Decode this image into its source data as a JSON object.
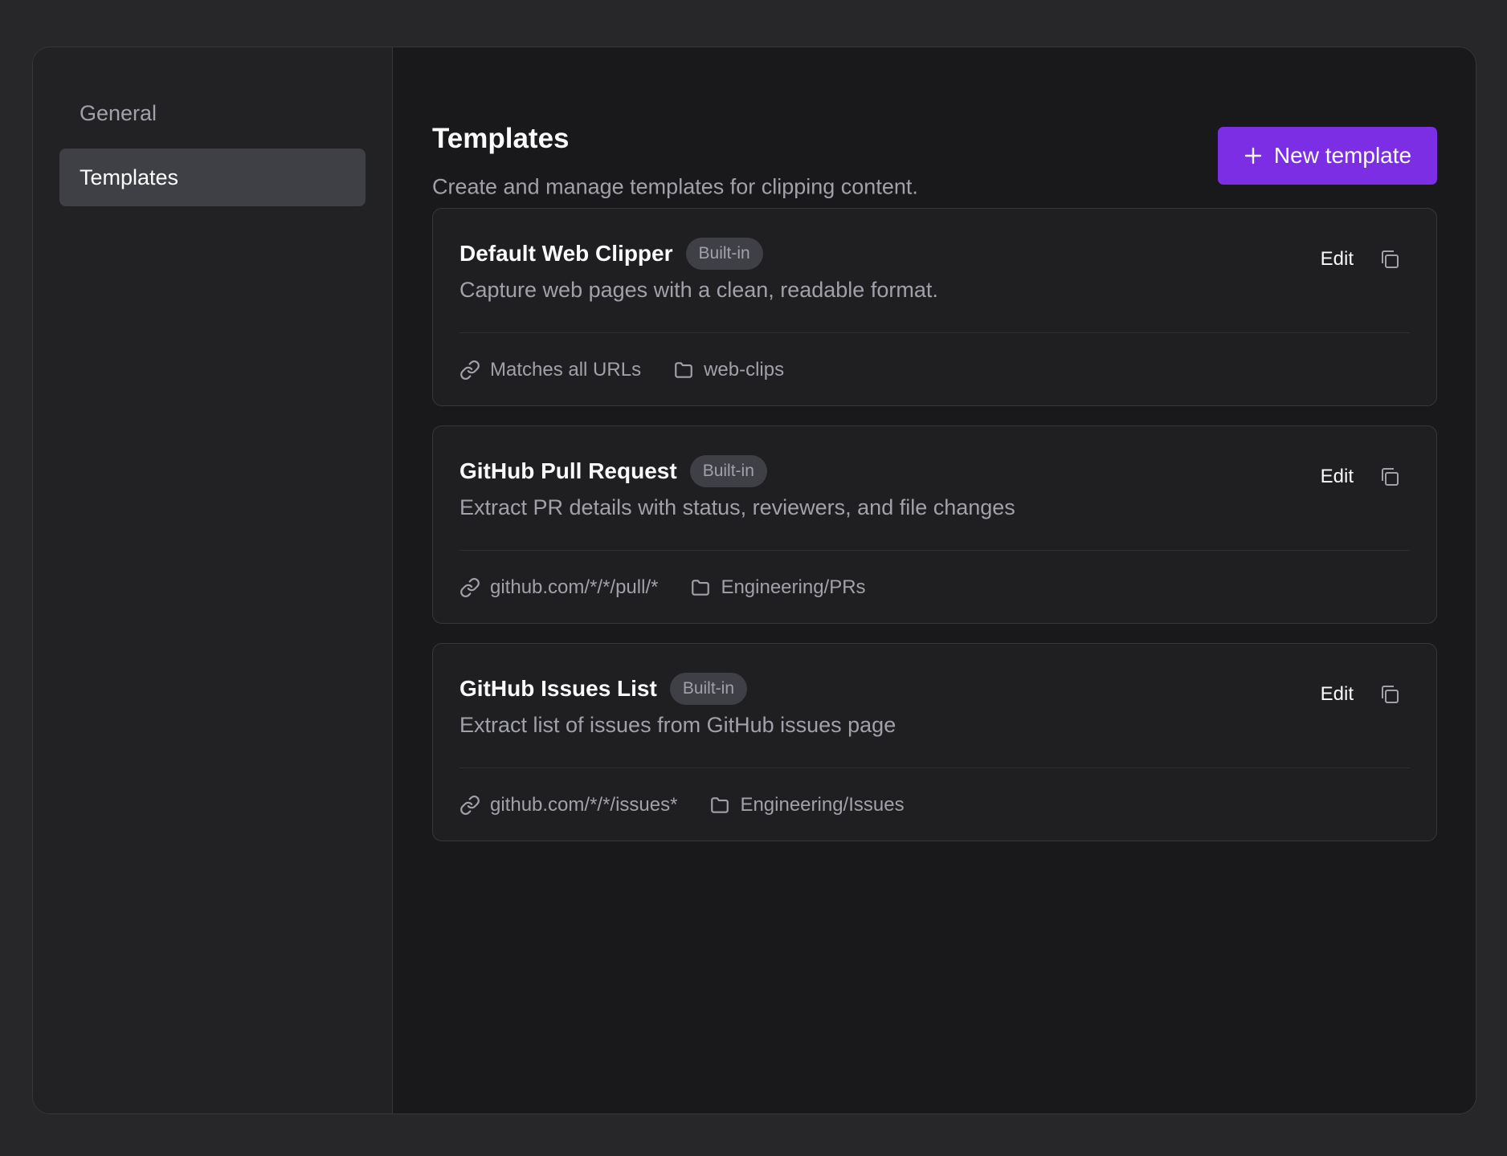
{
  "sidebar": {
    "items": [
      {
        "label": "General",
        "active": false
      },
      {
        "label": "Templates",
        "active": true
      }
    ]
  },
  "header": {
    "title": "Templates",
    "subtitle": "Create and manage templates for clipping content.",
    "new_button_label": "New template",
    "new_button_icon": "plus-icon"
  },
  "templates": [
    {
      "name": "Default Web Clipper",
      "badge": "Built-in",
      "description": "Capture web pages with a clean, readable format.",
      "url_pattern": "Matches all URLs",
      "folder": "web-clips",
      "edit_label": "Edit"
    },
    {
      "name": "GitHub Pull Request",
      "badge": "Built-in",
      "description": "Extract PR details with status, reviewers, and file changes",
      "url_pattern": "github.com/*/*/pull/*",
      "folder": "Engineering/PRs",
      "edit_label": "Edit"
    },
    {
      "name": "GitHub Issues List",
      "badge": "Built-in",
      "description": "Extract list of issues from GitHub issues page",
      "url_pattern": "github.com/*/*/issues*",
      "folder": "Engineering/Issues",
      "edit_label": "Edit"
    }
  ],
  "colors": {
    "accent": "#7c2ee4",
    "background": "#27272a",
    "panel": "#19191b",
    "active_nav": "#3f3f46"
  }
}
